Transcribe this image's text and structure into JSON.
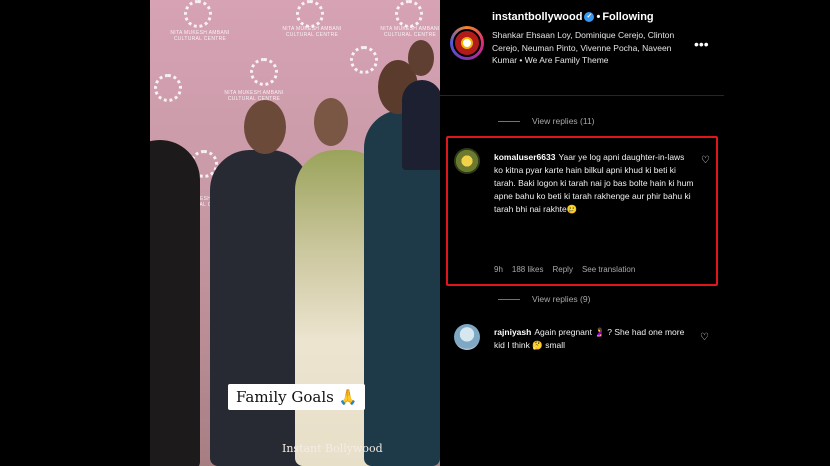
{
  "media": {
    "caption_chip": "Family Goals 🙏",
    "watermark": "Instant Bollywood",
    "backdrop_logo": "NITA MUKESH AMBANI CULTURAL CENTRE"
  },
  "post": {
    "username": "instantbollywood",
    "follow_state": "Following",
    "audio": "Shankar Ehsaan Loy, Dominique Cerejo, Clinton Cerejo, Neuman Pinto, Vivenne Pocha, Naveen Kumar • We Are Family Theme",
    "more_icon": "•••"
  },
  "replies_top": "View replies (11)",
  "highlighted_comment": {
    "username": "komaluser6633",
    "text": "Yaar ye log apni daughter-in-laws ko kitna pyar karte hain bilkul apni khud ki beti ki tarah. Baki logon ki tarah nai jo bas bolte hain ki hum apne bahu ko beti ki tarah rakhenge aur phir bahu ki tarah bhi nai rakhte",
    "emoji": "🥲",
    "time": "9h",
    "likes": "188 likes",
    "reply": "Reply",
    "translation": "See translation"
  },
  "replies_bottom": "View replies (9)",
  "second_comment": {
    "username": "rajniyash",
    "text": "Again pregnant 🤰 ? She had one more kid I think 🤔 small"
  },
  "colors": {
    "highlight_border": "#e0161d",
    "muted_text": "#a8a8a8",
    "verified": "#3897f0"
  }
}
